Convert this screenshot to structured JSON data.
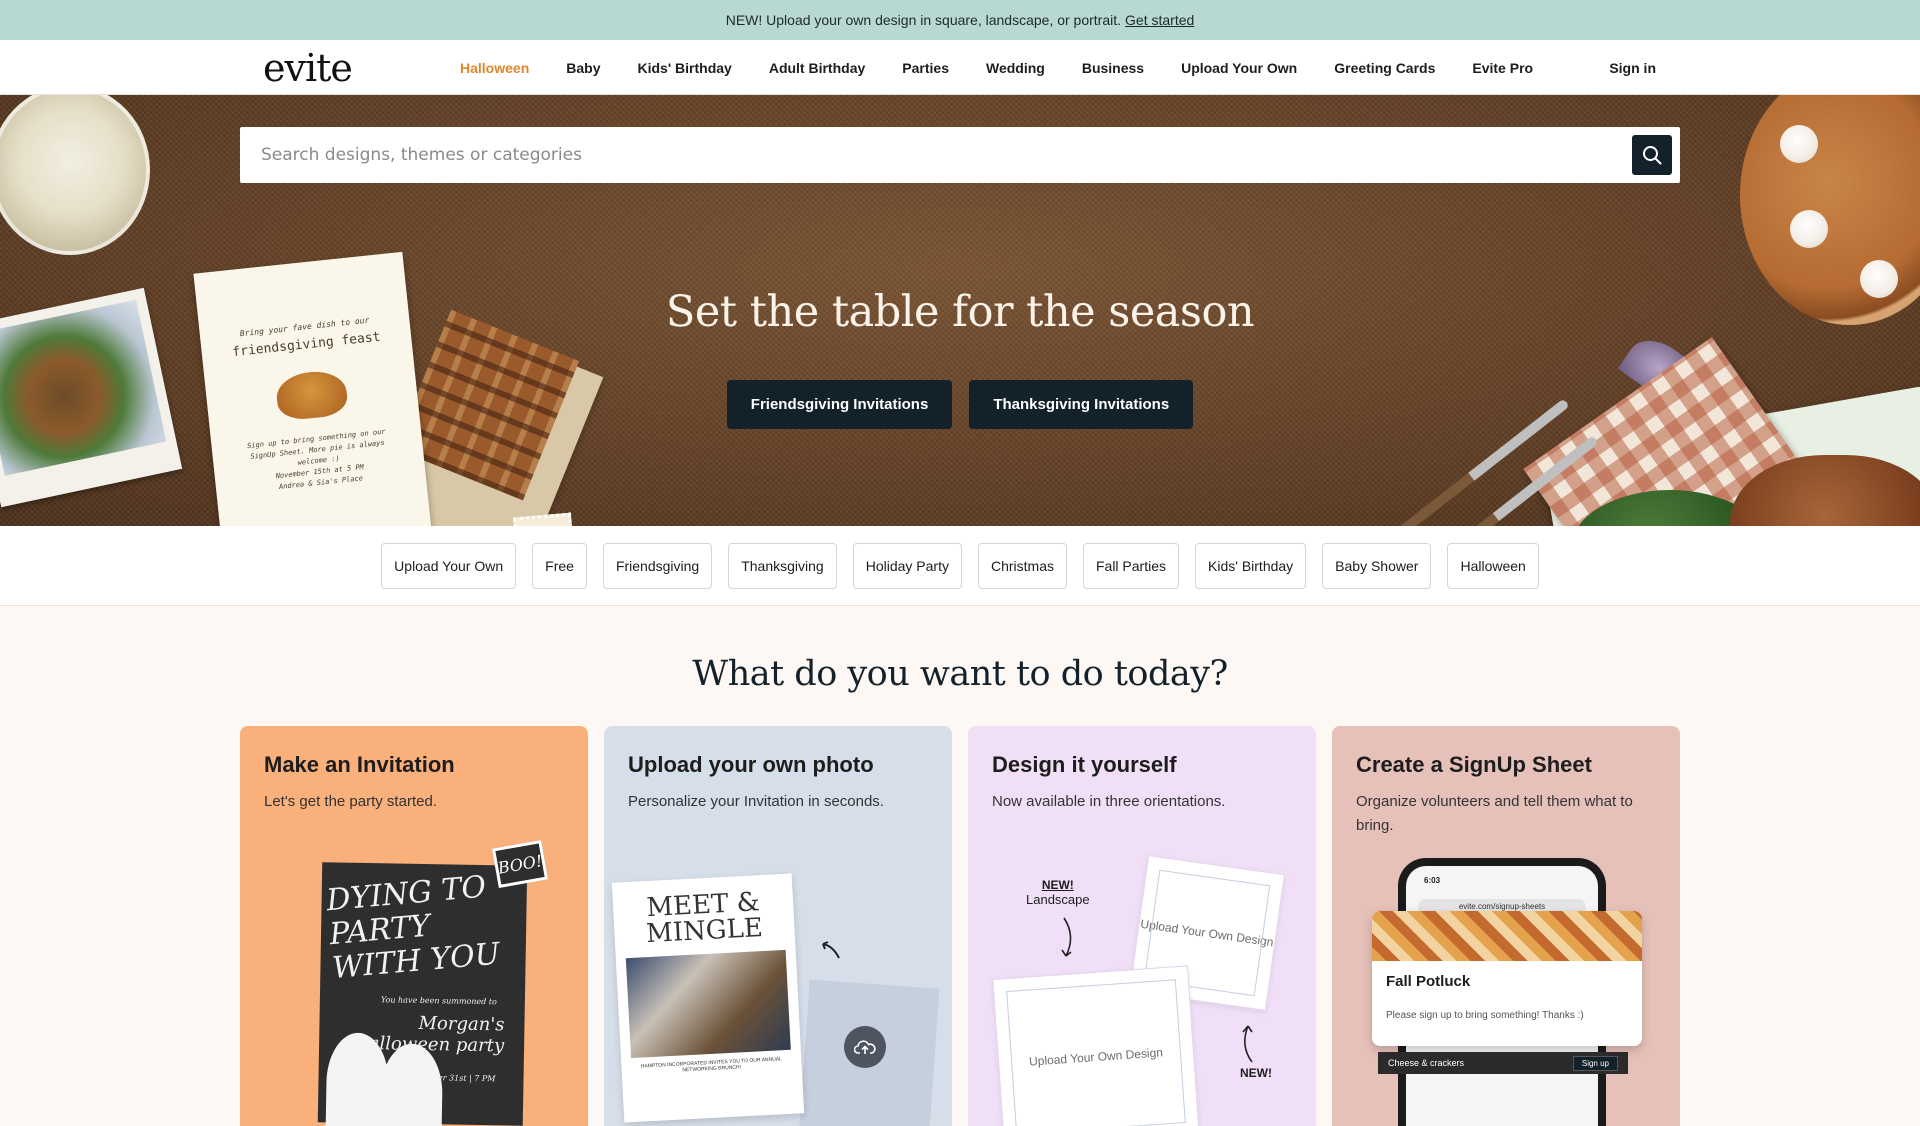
{
  "announcement": {
    "text": "NEW! Upload your own design in square, landscape, or portrait.",
    "link": "Get started"
  },
  "header": {
    "logo": "evite",
    "nav": [
      {
        "label": "Halloween",
        "active": true
      },
      {
        "label": "Baby"
      },
      {
        "label": "Kids' Birthday"
      },
      {
        "label": "Adult Birthday"
      },
      {
        "label": "Parties"
      },
      {
        "label": "Wedding"
      },
      {
        "label": "Business"
      },
      {
        "label": "Upload Your Own"
      },
      {
        "label": "Greeting Cards"
      },
      {
        "label": "Evite Pro"
      }
    ],
    "sign_in": "Sign in"
  },
  "hero": {
    "search_placeholder": "Search designs, themes or categories",
    "search_icon": "search-icon",
    "title": "Set the table for the season",
    "buttons": [
      "Friendsgiving Invitations",
      "Thanksgiving Invitations"
    ],
    "invite_card": {
      "line1": "Bring your fave dish to our",
      "line2": "friendsgiving feast",
      "line3": "Sign up to bring something on our SignUp Sheet. More pie is always welcome :)",
      "line4": "November 15th at 5 PM",
      "line5": "Andrea & Sia's Place"
    }
  },
  "chips": [
    "Upload Your Own",
    "Free",
    "Friendsgiving",
    "Thanksgiving",
    "Holiday Party",
    "Christmas",
    "Fall Parties",
    "Kids' Birthday",
    "Baby Shower",
    "Halloween"
  ],
  "today": {
    "title": "What do you want to do today?",
    "cards": [
      {
        "title": "Make an Invitation",
        "subtitle": "Let's get the party started.",
        "art": {
          "headline": "DYING TO PARTY WITH YOU",
          "badge": "BOO!",
          "small": "You have been summoned to",
          "name": "Morgan's halloween party",
          "date": "October 31st | 7 PM"
        }
      },
      {
        "title": "Upload your own photo",
        "subtitle": "Personalize your Invitation in seconds.",
        "art": {
          "headline": "MEET & MINGLE",
          "footer": "HAMPTON INCORPORATED INVITES YOU TO OUR ANNUAL NETWORKING BRUNCH!"
        }
      },
      {
        "title": "Design it yourself",
        "subtitle": "Now available in three orientations.",
        "art": {
          "new_label": "NEW!",
          "landscape_label": "Landscape",
          "upload_text": "Upload Your Own Design",
          "new_label_2": "NEW!"
        }
      },
      {
        "title": "Create a SignUp Sheet",
        "subtitle": "Organize volunteers and tell them what to bring.",
        "art": {
          "time": "6:03",
          "url": "evite.com/signup-sheets",
          "event": "Fall Potluck",
          "desc": "Please sign up to bring something! Thanks :)",
          "item": "Cheese & crackers",
          "signup": "Sign up"
        }
      }
    ]
  },
  "colors": {
    "banner": "#b8d8d4",
    "active_nav": "#e0852e",
    "button_dark": "#13212b",
    "card_invite": "#f9b07a",
    "card_upload": "#d6deea",
    "card_design": "#f1dff7",
    "card_signup": "#e6c1b9"
  }
}
